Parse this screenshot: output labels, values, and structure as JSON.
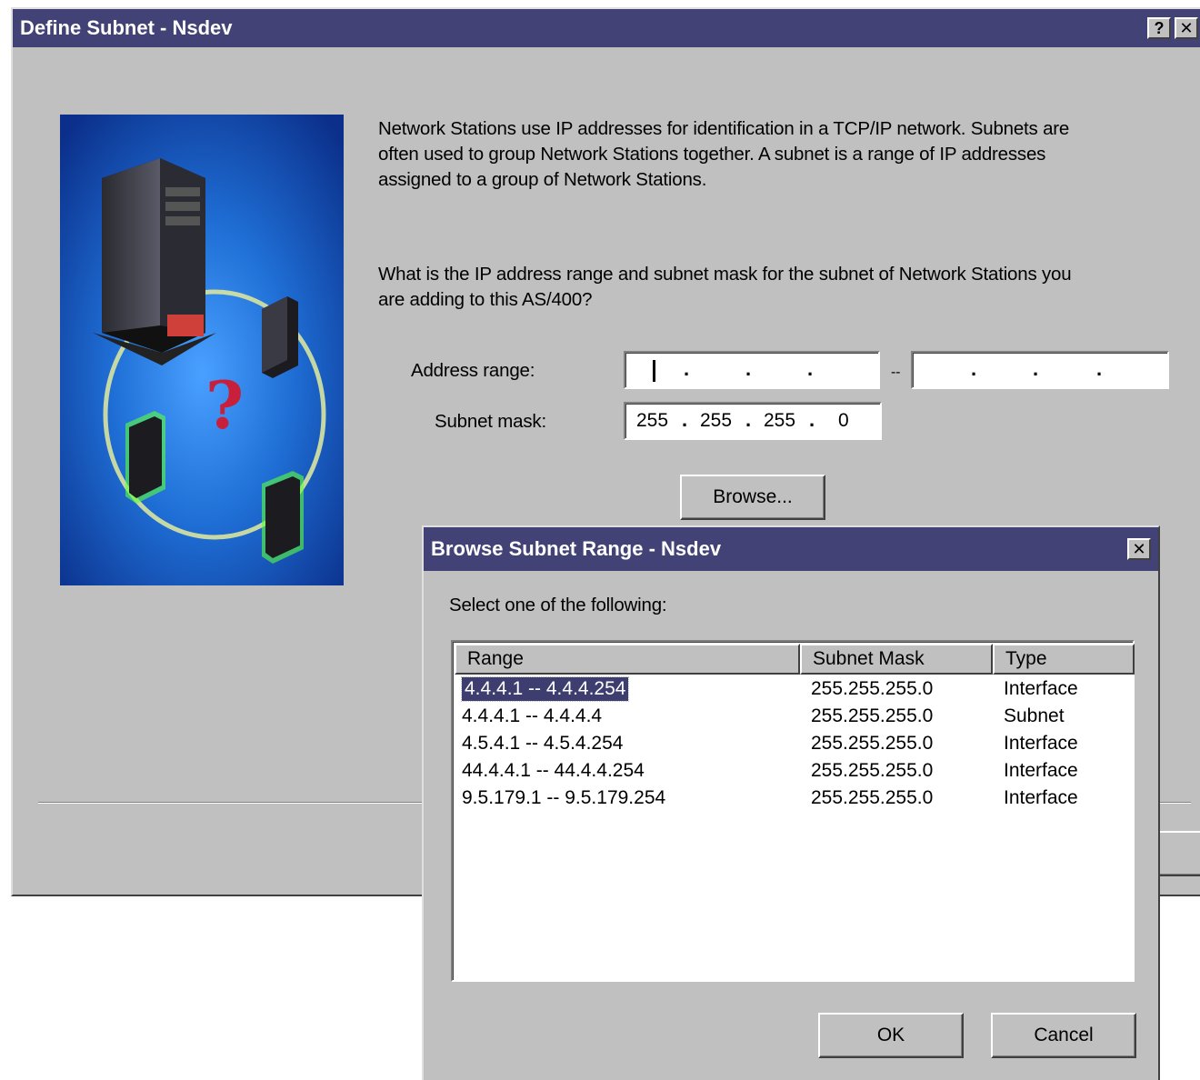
{
  "main_window": {
    "title": "Define Subnet - Nsdev",
    "help_glyph": "?",
    "close_glyph": "✕",
    "intro_lines": [
      "Network Stations use IP addresses for identification in a TCP/IP network.  Subnets are",
      "often used to group Network Stations together.  A subnet is a range of IP addresses",
      "assigned to a group of Network Stations."
    ],
    "question_lines": [
      "What is the IP address range and subnet mask for the subnet of Network Stations you",
      "are adding to this AS/400?"
    ],
    "address_range_label": "Address range:",
    "range_separator": "--",
    "address_start": [
      "",
      "",
      "",
      ""
    ],
    "address_end": [
      "",
      "",
      "",
      ""
    ],
    "subnet_mask_label": "Subnet mask:",
    "subnet_mask": [
      "255",
      "255",
      "255",
      "0"
    ],
    "browse_label": "Browse..."
  },
  "browse_dialog": {
    "title": "Browse Subnet Range - Nsdev",
    "close_glyph": "✕",
    "prompt": "Select one of the following:",
    "columns": [
      "Range",
      "Subnet Mask",
      "Type"
    ],
    "rows": [
      {
        "range": "4.4.4.1 -- 4.4.4.254",
        "mask": "255.255.255.0",
        "type": "Interface",
        "selected": true
      },
      {
        "range": "4.4.4.1 -- 4.4.4.4",
        "mask": "255.255.255.0",
        "type": "Subnet",
        "selected": false
      },
      {
        "range": "4.5.4.1 -- 4.5.4.254",
        "mask": "255.255.255.0",
        "type": "Interface",
        "selected": false
      },
      {
        "range": "44.4.4.1 -- 44.4.4.254",
        "mask": "255.255.255.0",
        "type": "Interface",
        "selected": false
      },
      {
        "range": "9.5.179.1 -- 9.5.179.254",
        "mask": "255.255.255.0",
        "type": "Interface",
        "selected": false
      }
    ],
    "ok_label": "OK",
    "cancel_label": "Cancel"
  },
  "colors": {
    "titlebar": "#424276",
    "face": "#c0c0c0",
    "selection": "#3d3d6f"
  },
  "icons": {
    "illustration": "server-network-stations-illustration"
  }
}
